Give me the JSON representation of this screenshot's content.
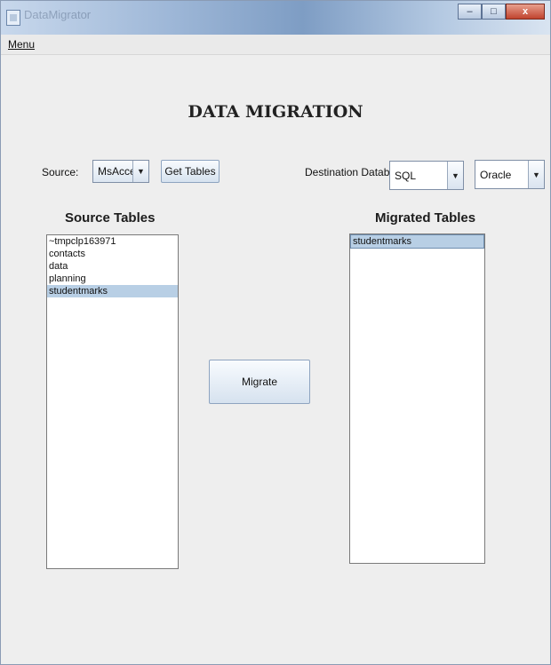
{
  "window": {
    "title": "DataMigrator"
  },
  "menu": {
    "label": "Menu"
  },
  "heading": "DATA MIGRATION",
  "source": {
    "label": "Source:",
    "selected": "MsAccess",
    "get_tables_label": "Get Tables"
  },
  "destination": {
    "label": "Destination Database:",
    "db_type": "SQL",
    "db_vendor": "Oracle"
  },
  "source_tables": {
    "title": "Source Tables",
    "items": [
      "~tmpclp163971",
      "contacts",
      "data",
      "planning",
      "studentmarks"
    ],
    "selected_index": 4
  },
  "migrate": {
    "label": "Migrate"
  },
  "migrated_tables": {
    "title": "Migrated Tables",
    "items": [
      "studentmarks"
    ],
    "selected_index": 0
  },
  "icons": {
    "app": "app-icon",
    "combo_arrow": "dropdown-arrow-icon"
  },
  "colors": {
    "selection": "#b8cfe5",
    "window_bg": "#eeeeee"
  }
}
